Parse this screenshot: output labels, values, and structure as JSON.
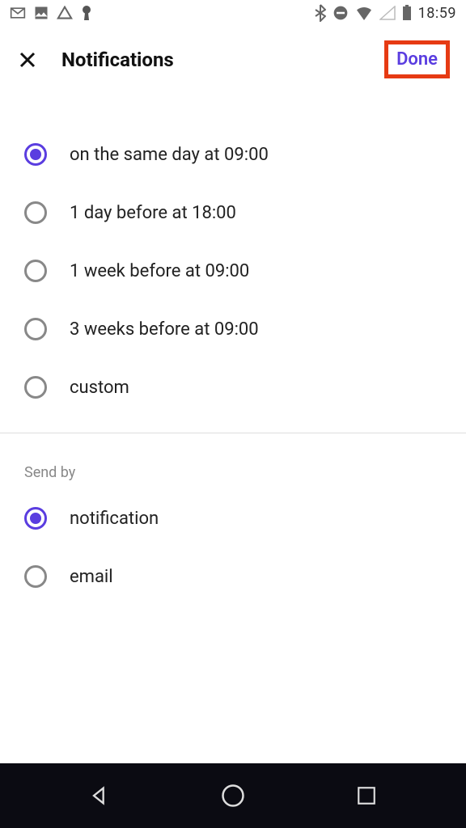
{
  "status_bar": {
    "time": "18:59"
  },
  "header": {
    "title": "Notifications",
    "done_label": "Done"
  },
  "timing_options": [
    {
      "label": "on the same day at 09:00",
      "selected": true
    },
    {
      "label": "1 day before at 18:00",
      "selected": false
    },
    {
      "label": "1 week before at 09:00",
      "selected": false
    },
    {
      "label": "3 weeks before at 09:00",
      "selected": false
    },
    {
      "label": "custom",
      "selected": false
    }
  ],
  "send_by": {
    "section_label": "Send by",
    "options": [
      {
        "label": "notification",
        "selected": true
      },
      {
        "label": "email",
        "selected": false
      }
    ]
  }
}
